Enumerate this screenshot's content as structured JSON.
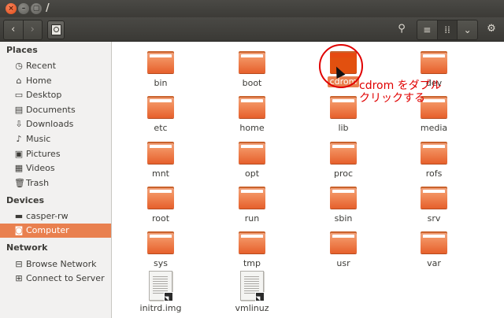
{
  "window": {
    "title": "/",
    "close_glyph": "×",
    "minimize_glyph": "–",
    "maximize_glyph": "▢"
  },
  "toolbar": {
    "back_icon": "‹",
    "forward_icon": "›",
    "search_icon": "⚲",
    "list_view_icon": "≡",
    "grid_view_icon": "⁞⁞",
    "view_options_icon": "⌄",
    "settings_icon": "⚙"
  },
  "sidebar": {
    "sections": [
      {
        "title": "Places",
        "items": [
          {
            "label": "Recent",
            "icon": "clock-icon",
            "glyph": "◷"
          },
          {
            "label": "Home",
            "icon": "home-icon",
            "glyph": "⌂"
          },
          {
            "label": "Desktop",
            "icon": "desktop-icon",
            "glyph": "▭"
          },
          {
            "label": "Documents",
            "icon": "documents-icon",
            "glyph": "▤"
          },
          {
            "label": "Downloads",
            "icon": "download-icon",
            "glyph": "⇩"
          },
          {
            "label": "Music",
            "icon": "music-icon",
            "glyph": "♪"
          },
          {
            "label": "Pictures",
            "icon": "pictures-icon",
            "glyph": "▣"
          },
          {
            "label": "Videos",
            "icon": "videos-icon",
            "glyph": "▦"
          },
          {
            "label": "Trash",
            "icon": "trash-icon",
            "glyph": "🗑"
          }
        ]
      },
      {
        "title": "Devices",
        "items": [
          {
            "label": "casper-rw",
            "icon": "drive-icon",
            "glyph": "▬"
          },
          {
            "label": "Computer",
            "icon": "computer-icon",
            "glyph": "◙",
            "active": true
          }
        ]
      },
      {
        "title": "Network",
        "items": [
          {
            "label": "Browse Network",
            "icon": "network-icon",
            "glyph": "⊟"
          },
          {
            "label": "Connect to Server",
            "icon": "server-icon",
            "glyph": "⊞"
          }
        ]
      }
    ]
  },
  "files": [
    {
      "name": "bin",
      "type": "folder"
    },
    {
      "name": "boot",
      "type": "folder"
    },
    {
      "name": "cdrom",
      "type": "folder",
      "selected": true,
      "label_shown": "cdrom"
    },
    {
      "name": "dev",
      "type": "folder"
    },
    {
      "name": "etc",
      "type": "folder"
    },
    {
      "name": "home",
      "type": "folder"
    },
    {
      "name": "lib",
      "type": "folder"
    },
    {
      "name": "media",
      "type": "folder"
    },
    {
      "name": "mnt",
      "type": "folder"
    },
    {
      "name": "opt",
      "type": "folder"
    },
    {
      "name": "proc",
      "type": "folder"
    },
    {
      "name": "rofs",
      "type": "folder"
    },
    {
      "name": "root",
      "type": "folder"
    },
    {
      "name": "run",
      "type": "folder"
    },
    {
      "name": "sbin",
      "type": "folder"
    },
    {
      "name": "srv",
      "type": "folder"
    },
    {
      "name": "sys",
      "type": "folder"
    },
    {
      "name": "tmp",
      "type": "folder"
    },
    {
      "name": "usr",
      "type": "folder"
    },
    {
      "name": "var",
      "type": "folder"
    },
    {
      "name": "initrd.img",
      "type": "file"
    },
    {
      "name": "vmlinuz",
      "type": "file"
    }
  ],
  "annotation": {
    "text_line1": "cdrom をダブル",
    "text_line2": "クリックする",
    "color": "#e00000"
  },
  "colors": {
    "accent": "#e9804f",
    "folder": "#e6602c",
    "titlebar": "#3c3b37"
  }
}
